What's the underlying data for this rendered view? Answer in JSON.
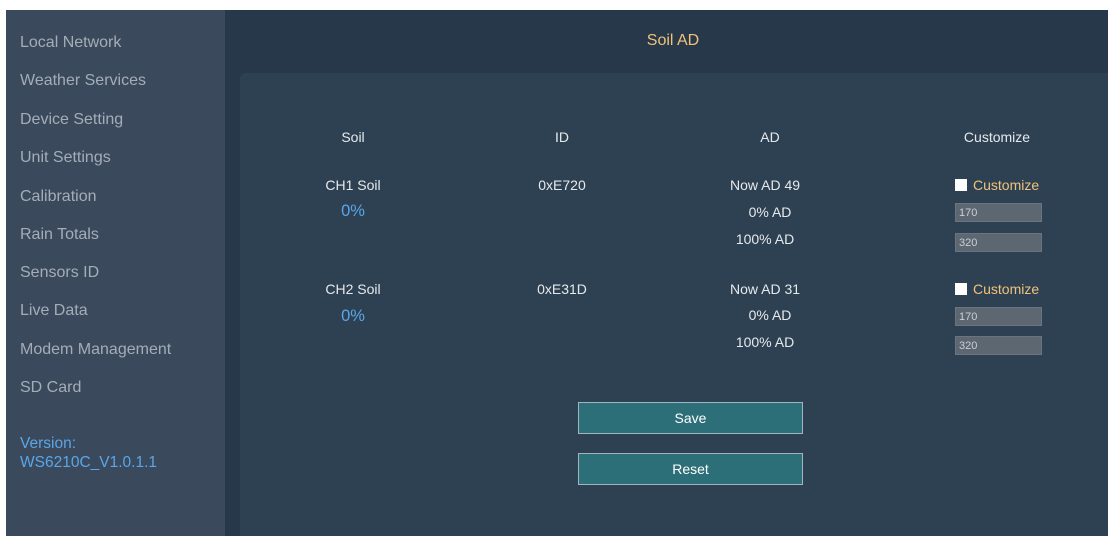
{
  "sidebar": {
    "items": [
      {
        "label": "Local Network"
      },
      {
        "label": "Weather Services"
      },
      {
        "label": "Device Setting"
      },
      {
        "label": "Unit Settings"
      },
      {
        "label": "Calibration"
      },
      {
        "label": "Rain Totals"
      },
      {
        "label": "Sensors ID"
      },
      {
        "label": "Live Data"
      },
      {
        "label": "Modem Management"
      },
      {
        "label": "SD Card"
      }
    ],
    "version_label": "Version:",
    "version_value": "WS6210C_V1.0.1.1"
  },
  "main": {
    "title": "Soil AD",
    "columns": {
      "soil": "Soil",
      "id": "ID",
      "ad": "AD",
      "customize": "Customize"
    },
    "channels": [
      {
        "name": "CH1 Soil",
        "percent": "0%",
        "id": "0xE720",
        "now_ad": "Now AD 49",
        "zero_ad_label": "0% AD",
        "hundred_ad_label": "100% AD",
        "customize_label": "Customize",
        "customize_checked": false,
        "zero_value": "170",
        "hundred_value": "320"
      },
      {
        "name": "CH2 Soil",
        "percent": "0%",
        "id": "0xE31D",
        "now_ad": "Now AD 31",
        "zero_ad_label": "0% AD",
        "hundred_ad_label": "100% AD",
        "customize_label": "Customize",
        "customize_checked": false,
        "zero_value": "170",
        "hundred_value": "320"
      }
    ],
    "save_label": "Save",
    "reset_label": "Reset"
  },
  "colors": {
    "accent_title": "#f0c27a",
    "percent_blue": "#5aa6e8",
    "button_teal": "#2d6f79"
  }
}
